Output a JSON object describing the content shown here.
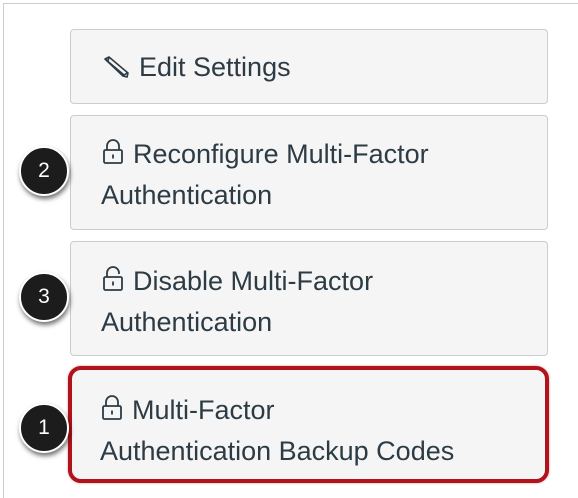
{
  "buttons": {
    "edit_settings": {
      "label": "Edit Settings",
      "icon": "pencil-icon"
    },
    "reconfigure_mfa": {
      "line1": "Reconfigure Multi-Factor",
      "line2": "Authentication",
      "icon": "lock-icon"
    },
    "disable_mfa": {
      "line1": "Disable Multi-Factor",
      "line2": "Authentication",
      "icon": "unlock-icon"
    },
    "backup_codes": {
      "line1": "Multi-Factor",
      "line2": "Authentication Backup Codes",
      "icon": "lock-icon"
    }
  },
  "callouts": {
    "reconfigure": "2",
    "disable": "3",
    "backup": "1"
  },
  "colors": {
    "highlight": "#b0131b",
    "button_bg": "#f5f5f5",
    "text": "#2d3b45",
    "badge": "#1c1c1c"
  }
}
